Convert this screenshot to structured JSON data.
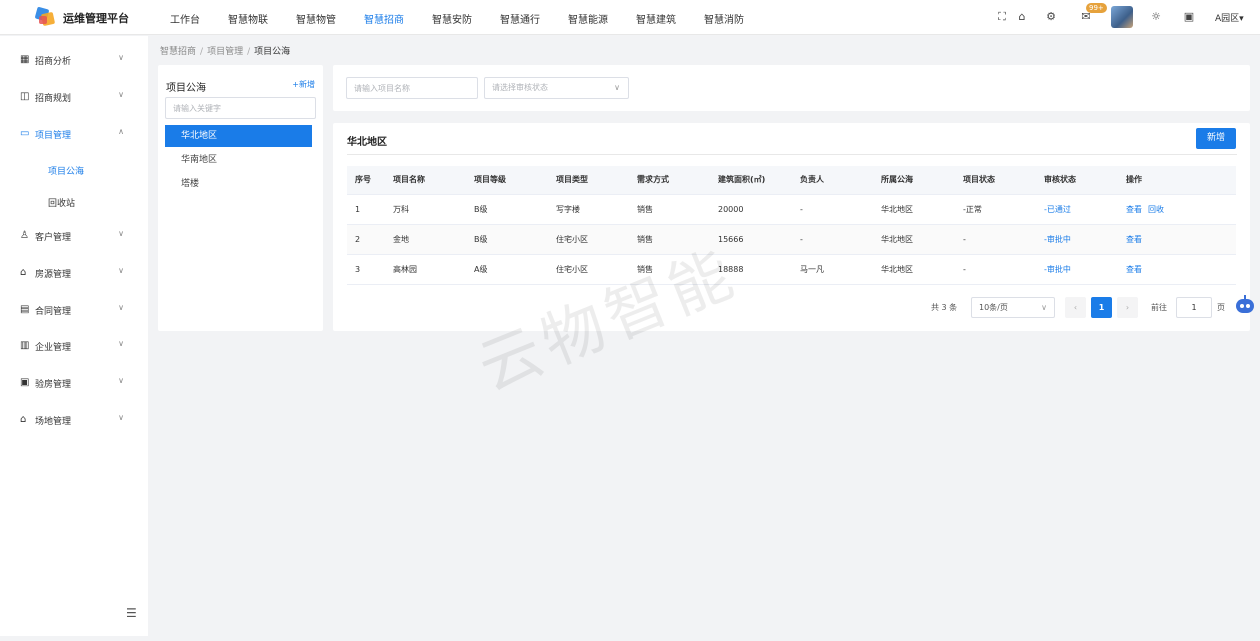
{
  "app": {
    "title": "运维管理平台"
  },
  "topnav": {
    "items": [
      "工作台",
      "智慧物联",
      "智慧物管",
      "智慧招商",
      "智慧安防",
      "智慧通行",
      "智慧能源",
      "智慧建筑",
      "智慧消防"
    ],
    "active_index": 3
  },
  "header": {
    "message_badge": "99+",
    "zone": "A园区▾"
  },
  "sidebar": {
    "items": [
      {
        "label": "招商分析",
        "icon": "chart-icon"
      },
      {
        "label": "招商规划",
        "icon": "plan-icon"
      },
      {
        "label": "项目管理",
        "icon": "folder-icon"
      },
      {
        "label": "客户管理",
        "icon": "user-icon"
      },
      {
        "label": "房源管理",
        "icon": "house-icon"
      },
      {
        "label": "合同管理",
        "icon": "contract-icon"
      },
      {
        "label": "企业管理",
        "icon": "enterprise-icon"
      },
      {
        "label": "验房管理",
        "icon": "inspect-icon"
      },
      {
        "label": "场地管理",
        "icon": "site-icon"
      }
    ],
    "subitems": [
      "项目公海",
      "回收站"
    ]
  },
  "breadcrumb": [
    "智慧招商",
    "项目管理",
    "项目公海"
  ],
  "left_panel": {
    "title": "项目公海",
    "add_label": "+新增",
    "search_placeholder": "请输入关键字",
    "regions": [
      "华北地区",
      "华南地区",
      "塔楼"
    ]
  },
  "filters": {
    "name_placeholder": "请输入项目名称",
    "status_placeholder": "请选择审核状态"
  },
  "main": {
    "title": "华北地区",
    "add_button": "新增",
    "columns": [
      "序号",
      "项目名称",
      "项目等级",
      "项目类型",
      "需求方式",
      "建筑面积(㎡)",
      "负责人",
      "所属公海",
      "项目状态",
      "审核状态",
      "操作"
    ],
    "rows": [
      {
        "no": "1",
        "name": "万科",
        "level": "B级",
        "type": "写字楼",
        "demand": "销售",
        "area": "20000",
        "owner": "-",
        "sea": "华北地区",
        "status": "-正常",
        "audit": "-已通过",
        "actions": [
          "查看",
          "回收"
        ]
      },
      {
        "no": "2",
        "name": "金地",
        "level": "B级",
        "type": "住宅小区",
        "demand": "销售",
        "area": "15666",
        "owner": "-",
        "sea": "华北地区",
        "status": "-",
        "audit": "-审批中",
        "actions": [
          "查看"
        ]
      },
      {
        "no": "3",
        "name": "高林园",
        "level": "A级",
        "type": "住宅小区",
        "demand": "销售",
        "area": "18888",
        "owner": "马一凡",
        "sea": "华北地区",
        "status": "-",
        "audit": "-审批中",
        "actions": [
          "查看"
        ]
      }
    ]
  },
  "pagination": {
    "total": "共 3 条",
    "page_size": "10条/页",
    "prev": "‹",
    "current": "1",
    "next": "›",
    "goto_label": "前往",
    "goto_value": "1",
    "page_suffix": "页"
  },
  "watermark": "云物智能",
  "colors": {
    "accent": "#1a7ce8"
  }
}
